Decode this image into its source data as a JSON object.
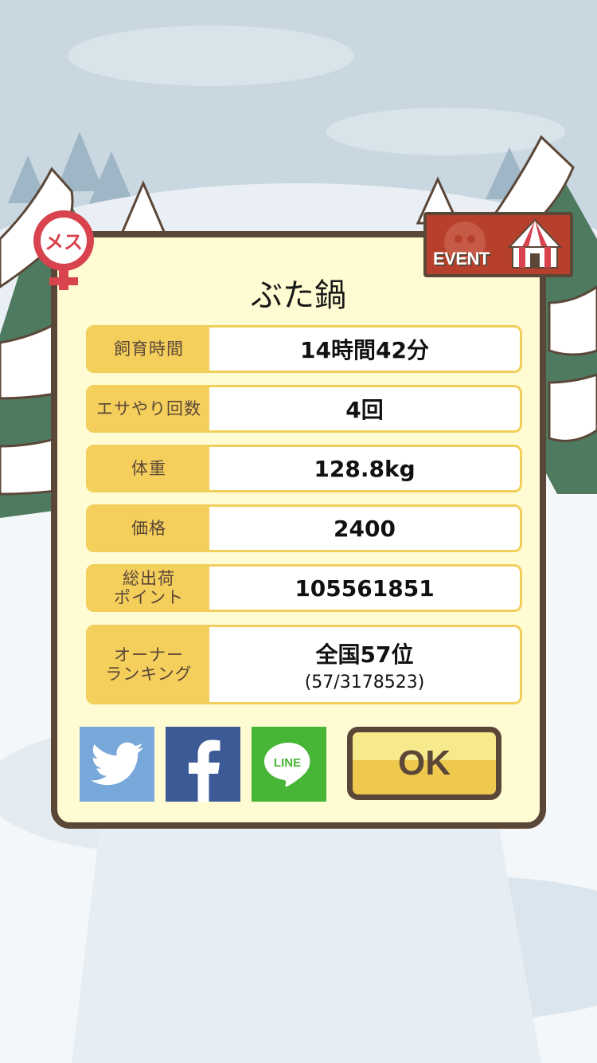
{
  "dialog": {
    "title": "ぶた鍋",
    "stats": [
      {
        "label": "飼育時間",
        "value": "14時間42分"
      },
      {
        "label": "エサやり回数",
        "value": "4回"
      },
      {
        "label": "体重",
        "value": "128.8kg"
      },
      {
        "label": "価格",
        "value": "2400"
      },
      {
        "label": "総出荷\nポイント",
        "value": "105561851"
      },
      {
        "label": "オーナー\nランキング",
        "value": "全国57位",
        "sub": "(57/3178523)"
      }
    ],
    "ok_label": "OK"
  },
  "badges": {
    "gender_text": "メス",
    "event_text": "EVENT"
  },
  "social": {
    "twitter_icon": "twitter-bird-icon",
    "facebook_icon": "facebook-f-icon",
    "line_icon": "line-icon",
    "line_text": "LINE"
  },
  "colors": {
    "dialog_bg": "#fffbd2",
    "border": "#5b4738",
    "label_bg": "#f4cf5c",
    "twitter": "#78a7d9",
    "facebook": "#3b5a96",
    "line": "#47b535",
    "event": "#b7402d"
  }
}
